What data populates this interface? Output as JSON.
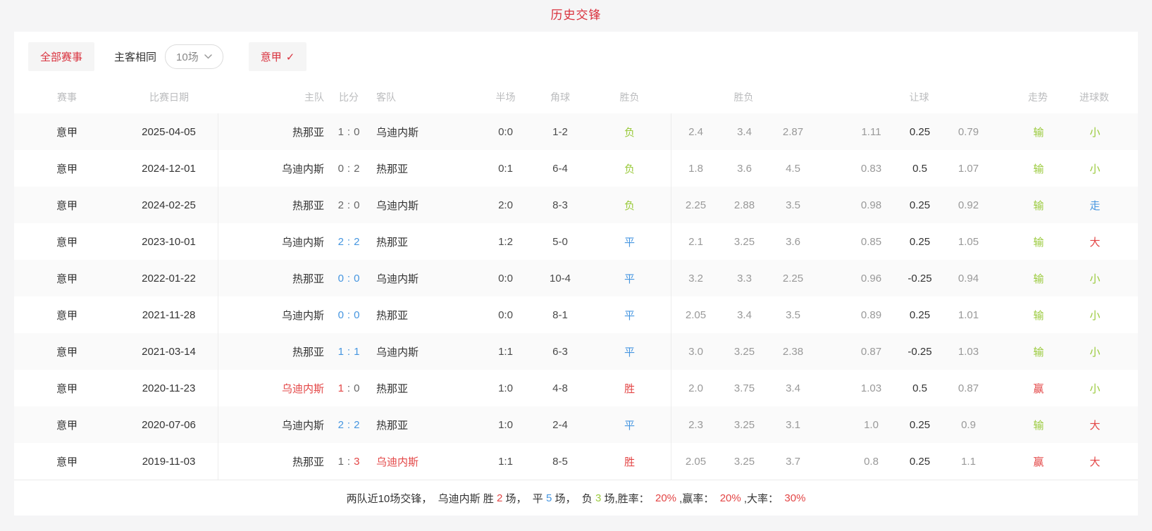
{
  "page": {
    "title": "历史交锋",
    "colors": {
      "accent_red": "#d9323e",
      "cell_red": "#e34545",
      "cell_blue": "#4696e0",
      "cell_green": "#9aca3c"
    }
  },
  "filters": {
    "all_events_label": "全部赛事",
    "same_venue_label": "主客相同",
    "count_selected": "10场",
    "chevron_icon": "chevron-down",
    "league_label": "意甲",
    "league_check": "✓"
  },
  "table": {
    "headers": {
      "league": "赛事",
      "date": "比赛日期",
      "home": "主队",
      "score": "比分",
      "away": "客队",
      "half": "半场",
      "corner": "角球",
      "result": "胜负",
      "odds_group": "胜负",
      "handicap_group": "让球",
      "trend": "走势",
      "goals": "进球数"
    },
    "rows": [
      {
        "league": "意甲",
        "date": "2025-04-05",
        "home": "热那亚",
        "home_color": "dark",
        "score_home": "1",
        "score_home_color": "gray",
        "colon_color": "gray",
        "score_away": "0",
        "score_away_color": "gray",
        "away": "乌迪内斯",
        "away_color": "dark",
        "half": "0:0",
        "corner": "1-2",
        "result": "负",
        "result_color": "green",
        "odds": [
          "2.4",
          "3.4",
          "2.87"
        ],
        "handicap": [
          "1.11",
          "0.25",
          "0.79"
        ],
        "trend": "输",
        "trend_color": "green",
        "goals": "小",
        "goals_color": "green"
      },
      {
        "league": "意甲",
        "date": "2024-12-01",
        "home": "乌迪内斯",
        "home_color": "dark",
        "score_home": "0",
        "score_home_color": "gray",
        "colon_color": "gray",
        "score_away": "2",
        "score_away_color": "gray",
        "away": "热那亚",
        "away_color": "dark",
        "half": "0:1",
        "corner": "6-4",
        "result": "负",
        "result_color": "green",
        "odds": [
          "1.8",
          "3.6",
          "4.5"
        ],
        "handicap": [
          "0.83",
          "0.5",
          "1.07"
        ],
        "trend": "输",
        "trend_color": "green",
        "goals": "小",
        "goals_color": "green"
      },
      {
        "league": "意甲",
        "date": "2024-02-25",
        "home": "热那亚",
        "home_color": "dark",
        "score_home": "2",
        "score_home_color": "gray",
        "colon_color": "gray",
        "score_away": "0",
        "score_away_color": "gray",
        "away": "乌迪内斯",
        "away_color": "dark",
        "half": "2:0",
        "corner": "8-3",
        "result": "负",
        "result_color": "green",
        "odds": [
          "2.25",
          "2.88",
          "3.5"
        ],
        "handicap": [
          "0.98",
          "0.25",
          "0.92"
        ],
        "trend": "输",
        "trend_color": "green",
        "goals": "走",
        "goals_color": "blue"
      },
      {
        "league": "意甲",
        "date": "2023-10-01",
        "home": "乌迪内斯",
        "home_color": "dark",
        "score_home": "2",
        "score_home_color": "blue",
        "colon_color": "blue",
        "score_away": "2",
        "score_away_color": "blue",
        "away": "热那亚",
        "away_color": "dark",
        "half": "1:2",
        "corner": "5-0",
        "result": "平",
        "result_color": "blue",
        "odds": [
          "2.1",
          "3.25",
          "3.6"
        ],
        "handicap": [
          "0.85",
          "0.25",
          "1.05"
        ],
        "trend": "输",
        "trend_color": "green",
        "goals": "大",
        "goals_color": "red"
      },
      {
        "league": "意甲",
        "date": "2022-01-22",
        "home": "热那亚",
        "home_color": "dark",
        "score_home": "0",
        "score_home_color": "blue",
        "colon_color": "blue",
        "score_away": "0",
        "score_away_color": "blue",
        "away": "乌迪内斯",
        "away_color": "dark",
        "half": "0:0",
        "corner": "10-4",
        "result": "平",
        "result_color": "blue",
        "odds": [
          "3.2",
          "3.3",
          "2.25"
        ],
        "handicap": [
          "0.96",
          "-0.25",
          "0.94"
        ],
        "trend": "输",
        "trend_color": "green",
        "goals": "小",
        "goals_color": "green"
      },
      {
        "league": "意甲",
        "date": "2021-11-28",
        "home": "乌迪内斯",
        "home_color": "dark",
        "score_home": "0",
        "score_home_color": "blue",
        "colon_color": "blue",
        "score_away": "0",
        "score_away_color": "blue",
        "away": "热那亚",
        "away_color": "dark",
        "half": "0:0",
        "corner": "8-1",
        "result": "平",
        "result_color": "blue",
        "odds": [
          "2.05",
          "3.4",
          "3.5"
        ],
        "handicap": [
          "0.89",
          "0.25",
          "1.01"
        ],
        "trend": "输",
        "trend_color": "green",
        "goals": "小",
        "goals_color": "green"
      },
      {
        "league": "意甲",
        "date": "2021-03-14",
        "home": "热那亚",
        "home_color": "dark",
        "score_home": "1",
        "score_home_color": "blue",
        "colon_color": "blue",
        "score_away": "1",
        "score_away_color": "blue",
        "away": "乌迪内斯",
        "away_color": "dark",
        "half": "1:1",
        "corner": "6-3",
        "result": "平",
        "result_color": "blue",
        "odds": [
          "3.0",
          "3.25",
          "2.38"
        ],
        "handicap": [
          "0.87",
          "-0.25",
          "1.03"
        ],
        "trend": "输",
        "trend_color": "green",
        "goals": "小",
        "goals_color": "green"
      },
      {
        "league": "意甲",
        "date": "2020-11-23",
        "home": "乌迪内斯",
        "home_color": "red",
        "score_home": "1",
        "score_home_color": "red",
        "colon_color": "gray",
        "score_away": "0",
        "score_away_color": "gray",
        "away": "热那亚",
        "away_color": "dark",
        "half": "1:0",
        "corner": "4-8",
        "result": "胜",
        "result_color": "red",
        "odds": [
          "2.0",
          "3.75",
          "3.4"
        ],
        "handicap": [
          "1.03",
          "0.5",
          "0.87"
        ],
        "trend": "赢",
        "trend_color": "red",
        "goals": "小",
        "goals_color": "green"
      },
      {
        "league": "意甲",
        "date": "2020-07-06",
        "home": "乌迪内斯",
        "home_color": "dark",
        "score_home": "2",
        "score_home_color": "blue",
        "colon_color": "blue",
        "score_away": "2",
        "score_away_color": "blue",
        "away": "热那亚",
        "away_color": "dark",
        "half": "1:0",
        "corner": "2-4",
        "result": "平",
        "result_color": "blue",
        "odds": [
          "2.3",
          "3.25",
          "3.1"
        ],
        "handicap": [
          "1.0",
          "0.25",
          "0.9"
        ],
        "trend": "输",
        "trend_color": "green",
        "goals": "大",
        "goals_color": "red"
      },
      {
        "league": "意甲",
        "date": "2019-11-03",
        "home": "热那亚",
        "home_color": "dark",
        "score_home": "1",
        "score_home_color": "gray",
        "colon_color": "gray",
        "score_away": "3",
        "score_away_color": "red",
        "away": "乌迪内斯",
        "away_color": "red",
        "half": "1:1",
        "corner": "8-5",
        "result": "胜",
        "result_color": "red",
        "odds": [
          "2.05",
          "3.25",
          "3.7"
        ],
        "handicap": [
          "0.8",
          "0.25",
          "1.1"
        ],
        "trend": "赢",
        "trend_color": "red",
        "goals": "大",
        "goals_color": "red"
      }
    ]
  },
  "summary": {
    "segments": [
      {
        "text": "两队近10场交锋，  乌迪内斯 胜 ",
        "color": "dark"
      },
      {
        "text": "2",
        "color": "red"
      },
      {
        "text": " 场，  平 ",
        "color": "dark"
      },
      {
        "text": "5",
        "color": "blue"
      },
      {
        "text": " 场，  负 ",
        "color": "dark"
      },
      {
        "text": "3",
        "color": "green"
      },
      {
        "text": " 场,胜率：  ",
        "color": "dark"
      },
      {
        "text": "20%",
        "color": "red"
      },
      {
        "text": " ,赢率：  ",
        "color": "dark"
      },
      {
        "text": "20%",
        "color": "red"
      },
      {
        "text": " ,大率：  ",
        "color": "dark"
      },
      {
        "text": "30%",
        "color": "red"
      }
    ]
  }
}
